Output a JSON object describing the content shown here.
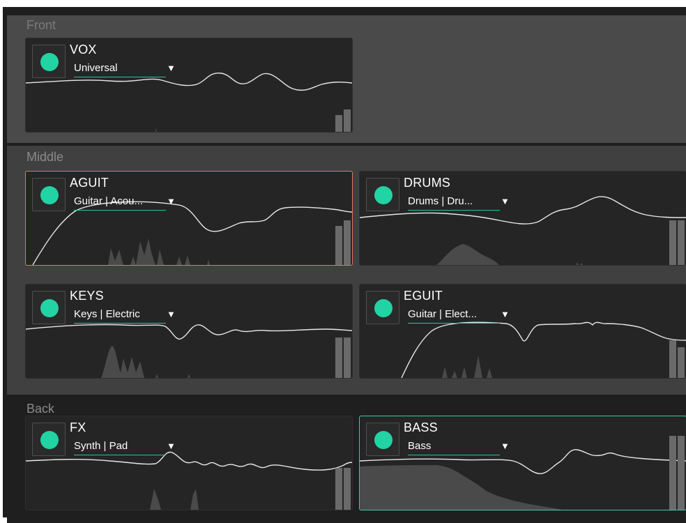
{
  "sections": {
    "front": {
      "title": "Front"
    },
    "middle": {
      "title": "Middle"
    },
    "back": {
      "title": "Back"
    }
  },
  "tracks": {
    "vox": {
      "name": "VOX",
      "preset": "Universal"
    },
    "aguit": {
      "name": "AGUIT",
      "preset": "Guitar | Acou..."
    },
    "drums": {
      "name": "DRUMS",
      "preset": "Drums | Dru..."
    },
    "keys": {
      "name": "KEYS",
      "preset": "Keys | Electric"
    },
    "eguit": {
      "name": "EGUIT",
      "preset": "Guitar | Elect..."
    },
    "fx": {
      "name": "FX",
      "preset": "Synth | Pad"
    },
    "bass": {
      "name": "BASS",
      "preset": "Bass"
    }
  },
  "icons": {
    "dropdown": "triangle-down-icon",
    "enable": "enable-dot-icon"
  },
  "colors": {
    "accent": "#22d3a4",
    "selected_orange": "#e07a55",
    "selected_teal": "#3cc9a8"
  }
}
